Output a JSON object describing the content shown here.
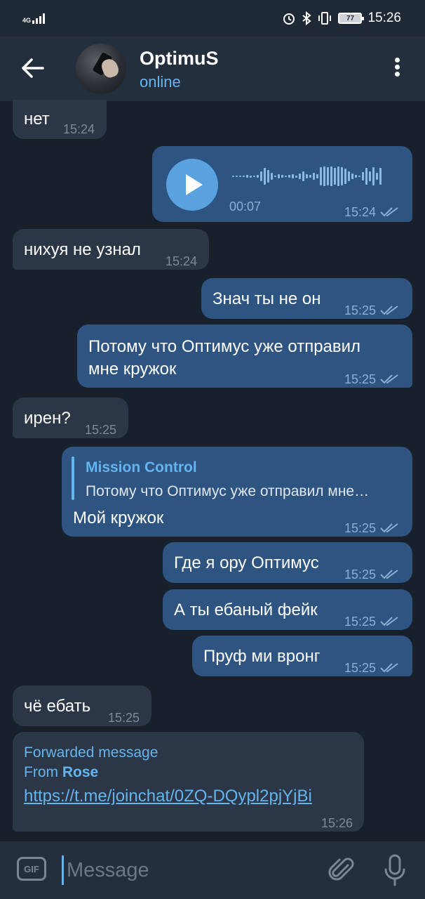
{
  "status_bar": {
    "network": "4G",
    "time": "15:26",
    "battery": "77"
  },
  "header": {
    "name": "OptimuS",
    "status": "online"
  },
  "messages": [
    {
      "dir": "in",
      "text": "нет",
      "time": "15:24"
    },
    {
      "dir": "out",
      "type": "voice",
      "duration": "00:07",
      "time": "15:24"
    },
    {
      "dir": "in",
      "text": "нихуя не узнал",
      "time": "15:24"
    },
    {
      "dir": "out",
      "text": "Знач ты не он",
      "time": "15:25"
    },
    {
      "dir": "out",
      "text_lines": [
        "Потому что Оптимус уже отправил",
        "мне кружок"
      ],
      "time": "15:25"
    },
    {
      "dir": "in",
      "text": "ирен?",
      "time": "15:25"
    },
    {
      "dir": "out",
      "reply_to": {
        "name": "Mission Control",
        "text": "Потому что Оптимус уже отправил мне…"
      },
      "text": "Мой кружок",
      "time": "15:25"
    },
    {
      "dir": "out",
      "text": "Где я ору Оптимус",
      "time": "15:25"
    },
    {
      "dir": "out",
      "text": "А ты ебаный фейк",
      "time": "15:25"
    },
    {
      "dir": "out",
      "text": "Пруф ми вронг",
      "time": "15:25"
    },
    {
      "dir": "in",
      "text": "чё ебать",
      "time": "15:25"
    },
    {
      "dir": "in",
      "forwarded": {
        "label": "Forwarded message",
        "from_prefix": "From",
        "from_name": "Rose"
      },
      "link": "https://t.me/joinchat/0ZQ-DQypl2pjYjBi",
      "time": "15:26"
    }
  ],
  "composer": {
    "gif_label": "GIF",
    "placeholder": "Message"
  },
  "colors": {
    "background": "#18202b",
    "header": "#242f3d",
    "incoming_bubble": "#2b3646",
    "outgoing_bubble": "#2e5482",
    "accent": "#64b5ef"
  }
}
